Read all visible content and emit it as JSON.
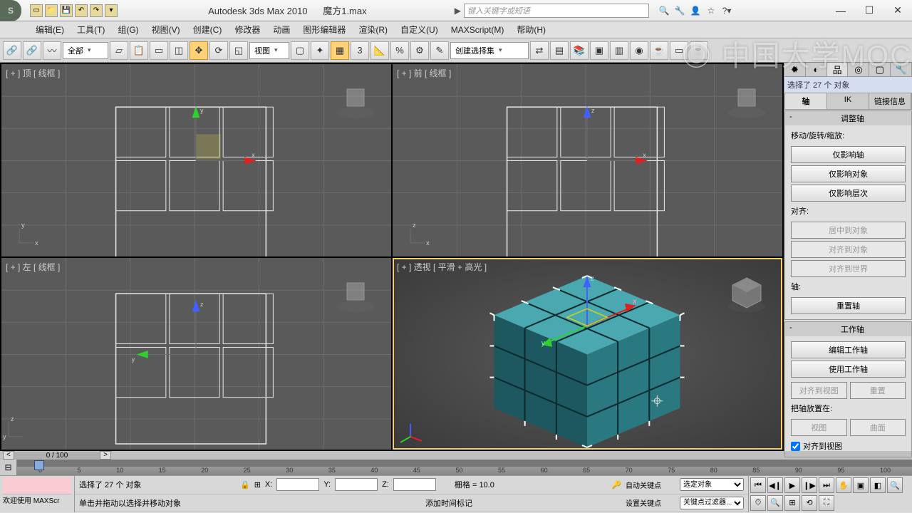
{
  "title": {
    "app": "Autodesk 3ds Max  2010",
    "file": "魔方1.max"
  },
  "search": {
    "placeholder": "键入关键字或短语"
  },
  "menu": [
    "编辑(E)",
    "工具(T)",
    "组(G)",
    "视图(V)",
    "创建(C)",
    "修改器",
    "动画",
    "图形编辑器",
    "渲染(R)",
    "自定义(U)",
    "MAXScript(M)",
    "帮助(H)"
  ],
  "toolbar": {
    "filter_combo": "全部",
    "coord_combo": "视图",
    "named_set": "创建选择集"
  },
  "viewports": {
    "top": "[ + ] 顶 [ 线框 ]",
    "front": "[ + ] 前 [ 线框 ]",
    "left": "[ + ] 左 [ 线框 ]",
    "persp": "[ + ] 透视 [ 平滑 + 高光 ]"
  },
  "sidepanel": {
    "selected": "选择了 27 个 对象",
    "subtabs": [
      "轴",
      "IK",
      "链接信息"
    ],
    "adjust_header": "调整轴",
    "move_label": "移动/旋转/缩放:",
    "affect_pivot": "仅影响轴",
    "affect_object": "仅影响对象",
    "affect_hier": "仅影响层次",
    "align_label": "对齐:",
    "center_obj": "居中到对象",
    "align_obj": "对齐到对象",
    "align_world": "对齐到世界",
    "pivot_label": "轴:",
    "reset_pivot": "重置轴",
    "waxis_header": "工作轴",
    "edit_waxis": "编辑工作轴",
    "use_waxis": "使用工作轴",
    "align_view": "对齐到视图",
    "reset": "重置",
    "place_label": "把轴放置在:",
    "btn_view": "视图",
    "btn_surface": "曲面",
    "chk_align_view": "对齐到视图"
  },
  "timeline": {
    "pos": "0 / 100"
  },
  "status": {
    "left1": "欢迎使用  MAXScr",
    "selected": "选择了 27 个 对象",
    "hint": "单击并拖动以选择并移动对象",
    "x": "X:",
    "y": "Y:",
    "z": "Z:",
    "grid": "栅格 = 10.0",
    "autokey": "自动关键点",
    "setkey": "设置关键点",
    "add_marker": "添加时间标记",
    "combo1": "选定对象",
    "combo2": "关键点过滤器..."
  },
  "watermark": "中国大学MOC"
}
